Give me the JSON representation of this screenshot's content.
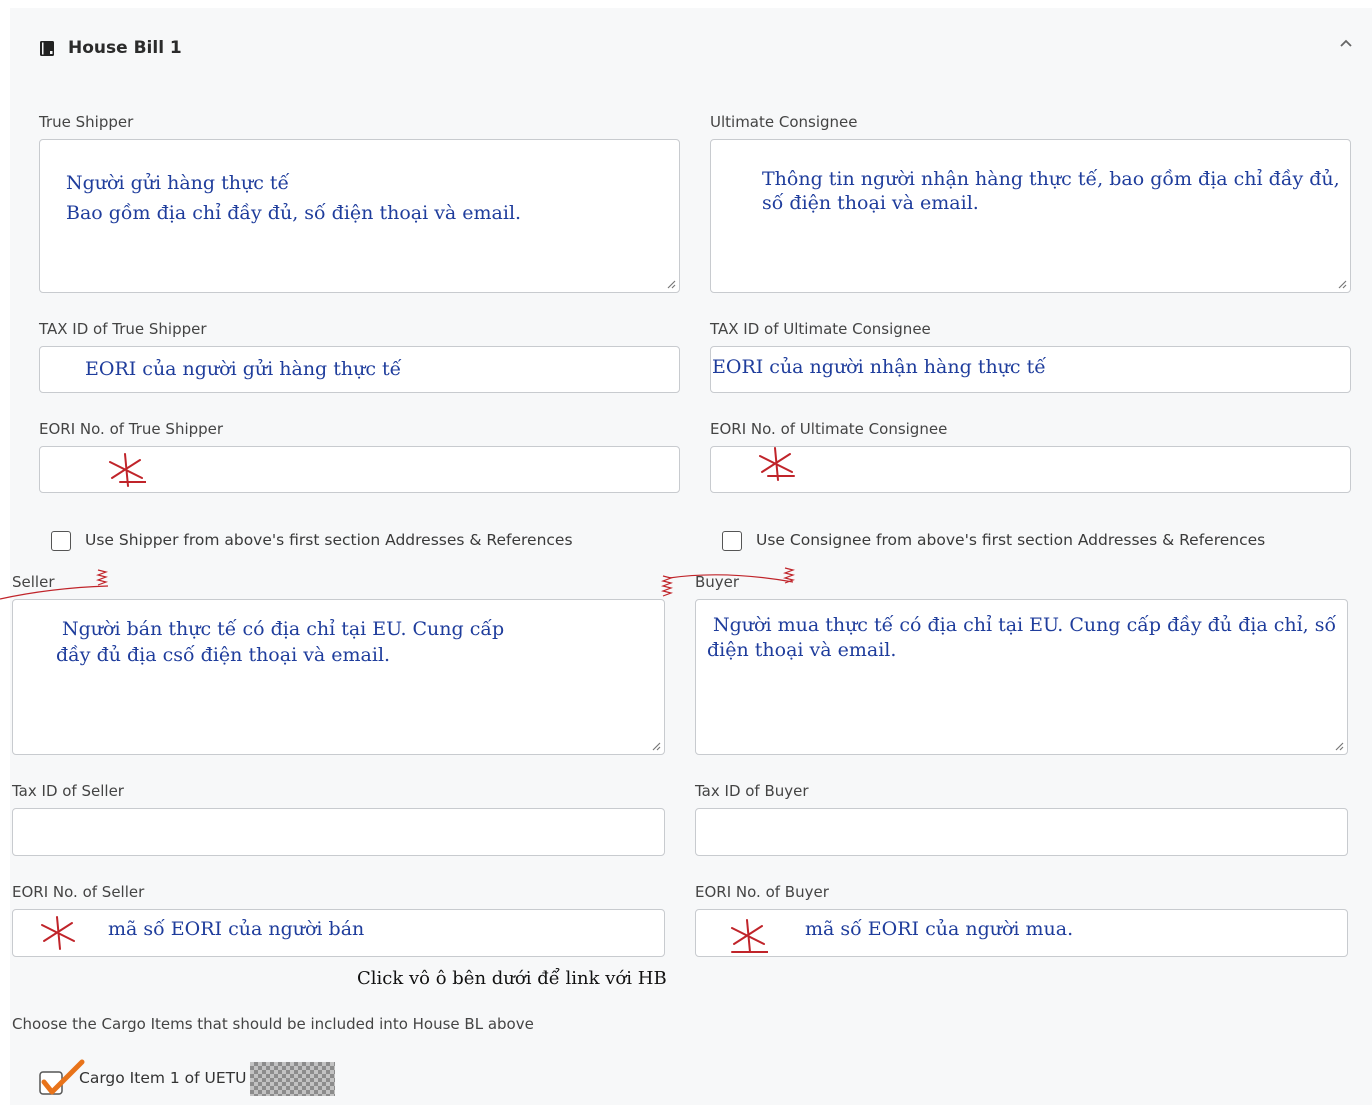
{
  "panel": {
    "title": "House Bill 1"
  },
  "left": {
    "true_shipper": {
      "label": "True Shipper",
      "note_line1": "Người gửi hàng thực tế",
      "note_line2": "Bao gồm địa chỉ đầy đủ, số điện thoại và email."
    },
    "tax_id_shipper": {
      "label": "TAX ID of True Shipper",
      "note": "EORI của người gửi hàng thực tế"
    },
    "eori_shipper": {
      "label": "EORI No. of True Shipper"
    },
    "use_shipper": {
      "label": "Use Shipper from above's first section Addresses & References",
      "checked": false
    },
    "seller": {
      "label": "Seller",
      "note_line1": "Người  bán thực tế có địa chỉ tại EU. Cung cấp",
      "note_line2": "đầy đủ địa csố điện thoại và email."
    },
    "tax_id_seller": {
      "label": "Tax ID of Seller"
    },
    "eori_seller": {
      "label": "EORI No. of Seller",
      "note": "mã số EORI của người bán"
    }
  },
  "right": {
    "ultimate_consignee": {
      "label": "Ultimate Consignee",
      "note_line1": "Thông tin người nhận hàng thực tế, bao gồm địa chỉ đầy đủ,",
      "note_line2": "số điện thoại và email."
    },
    "tax_id_consignee": {
      "label": "TAX ID of Ultimate Consignee",
      "note": "EORI của người nhận hàng thực tế"
    },
    "eori_consignee": {
      "label": "EORI No. of Ultimate Consignee"
    },
    "use_consignee": {
      "label": "Use Consignee from above's first section Addresses & References",
      "checked": false
    },
    "buyer": {
      "label": "Buyer",
      "note_line1": "Người mua thực tế có địa chỉ tại EU. Cung cấp đầy đủ địa chỉ, số",
      "note_line2": "điện thoại và email."
    },
    "tax_id_buyer": {
      "label": "Tax ID of Buyer"
    },
    "eori_buyer": {
      "label": "EORI No. of Buyer",
      "note": "mã số EORI của người mua."
    }
  },
  "instruction_note": "Click vô ô bên dưới để link với HB",
  "cargo": {
    "choose_label": "Choose the Cargo Items that should be included into House BL above",
    "items": [
      {
        "label": "Cargo Item 1 of UETU",
        "checked": true
      }
    ]
  },
  "colors": {
    "annotation_blue": "#1f3d9c",
    "annotation_red": "#c0242a",
    "check_orange": "#e8731a"
  }
}
